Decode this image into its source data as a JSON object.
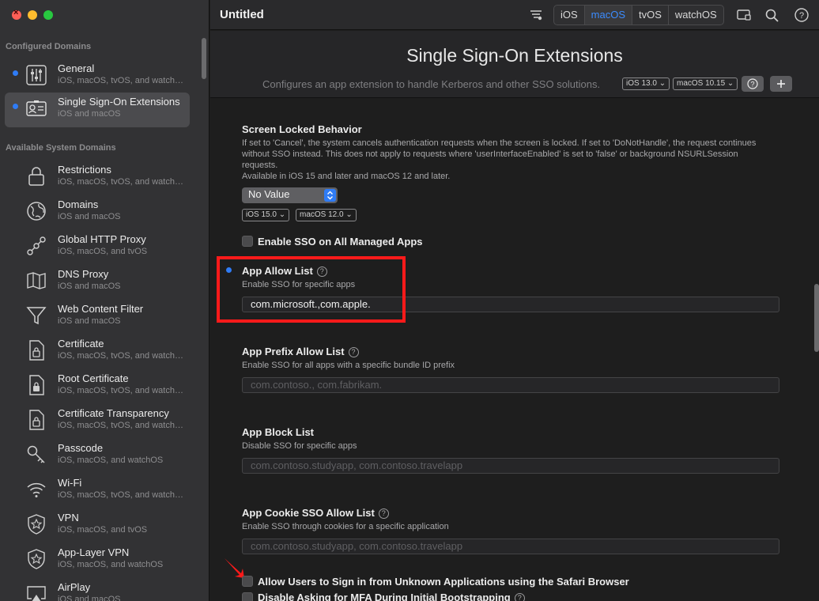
{
  "window": {
    "title": "Untitled"
  },
  "toolbar": {
    "platforms": [
      "iOS",
      "macOS",
      "tvOS",
      "watchOS"
    ],
    "active_platform": "macOS",
    "icons": [
      "filter-icon",
      "preview-icon",
      "search-icon",
      "help-icon"
    ]
  },
  "sidebar": {
    "configured_header": "Configured Domains",
    "available_header": "Available System Domains",
    "configured": [
      {
        "title": "General",
        "subtitle": "iOS, macOS, tvOS, and watchOS",
        "icon": "sliders-icon",
        "dot": true,
        "selected": false
      },
      {
        "title": "Single Sign-On Extensions",
        "subtitle": "iOS and macOS",
        "icon": "id-card-icon",
        "dot": true,
        "selected": true
      }
    ],
    "available": [
      {
        "title": "Restrictions",
        "subtitle": "iOS, macOS, tvOS, and watchOS",
        "icon": "lock-icon"
      },
      {
        "title": "Domains",
        "subtitle": "iOS and macOS",
        "icon": "globe-icon"
      },
      {
        "title": "Global HTTP Proxy",
        "subtitle": "iOS, macOS, and tvOS",
        "icon": "network-icon"
      },
      {
        "title": "DNS Proxy",
        "subtitle": "iOS and macOS",
        "icon": "map-icon"
      },
      {
        "title": "Web Content Filter",
        "subtitle": "iOS and macOS",
        "icon": "funnel-icon"
      },
      {
        "title": "Certificate",
        "subtitle": "iOS, macOS, tvOS, and watchOS",
        "icon": "certificate-icon"
      },
      {
        "title": "Root Certificate",
        "subtitle": "iOS, macOS, tvOS, and watchOS",
        "icon": "root-certificate-icon"
      },
      {
        "title": "Certificate Transparency",
        "subtitle": "iOS, macOS, tvOS, and watchOS",
        "icon": "certificate-transparency-icon"
      },
      {
        "title": "Passcode",
        "subtitle": "iOS, macOS, and watchOS",
        "icon": "key-icon"
      },
      {
        "title": "Wi-Fi",
        "subtitle": "iOS, macOS, tvOS, and watchOS",
        "icon": "wifi-icon"
      },
      {
        "title": "VPN",
        "subtitle": "iOS, macOS, and tvOS",
        "icon": "vpn-shield-icon"
      },
      {
        "title": "App-Layer VPN",
        "subtitle": "iOS, macOS, and watchOS",
        "icon": "app-vpn-shield-icon"
      },
      {
        "title": "AirPlay",
        "subtitle": "iOS and macOS",
        "icon": "airplay-icon"
      }
    ]
  },
  "payload": {
    "title": "Single Sign-On Extensions",
    "description": "Configures an app extension to handle Kerberos and other SSO solutions.",
    "ios_badge": "iOS  13.0",
    "macos_badge": "macOS  10.15"
  },
  "fields": {
    "screen_locked": {
      "title": "Screen Locked Behavior",
      "description": "If set to 'Cancel', the system cancels authentication requests when the screen is locked. If set to 'DoNotHandle', the request continues without SSO instead. This does not apply to requests where 'userInterfaceEnabled' is set to 'false' or background NSURLSession requests.",
      "availability": "Available in iOS 15 and later and macOS 12 and later.",
      "value": "No Value",
      "ios_badge": "iOS  15.0",
      "macos_badge": "macOS  12.0"
    },
    "enable_all": {
      "label": "Enable SSO on All Managed Apps",
      "checked": false
    },
    "app_allow": {
      "title": "App Allow List",
      "description": "Enable SSO for specific apps",
      "value": "com.microsoft.,com.apple."
    },
    "app_prefix": {
      "title": "App Prefix Allow List",
      "description": "Enable SSO for all apps with a specific bundle ID prefix",
      "placeholder": "com.contoso., com.fabrikam."
    },
    "app_block": {
      "title": "App Block List",
      "description": "Disable SSO for specific apps",
      "placeholder": "com.contoso.studyapp, com.contoso.travelapp"
    },
    "app_cookie": {
      "title": "App Cookie SSO Allow List",
      "description": "Enable SSO through cookies for a specific application",
      "placeholder": "com.contoso.studyapp, com.contoso.travelapp"
    },
    "allow_unknown": {
      "label": "Allow Users to Sign in from Unknown Applications using the Safari Browser",
      "checked": false
    },
    "disable_mfa": {
      "label": "Disable Asking for MFA During Initial Bootstrapping",
      "checked": false
    }
  },
  "colors": {
    "accent": "#2f7cf6",
    "highlight": "#ff1a1a",
    "sidebar": "#323234",
    "content": "#1e1e1e"
  }
}
